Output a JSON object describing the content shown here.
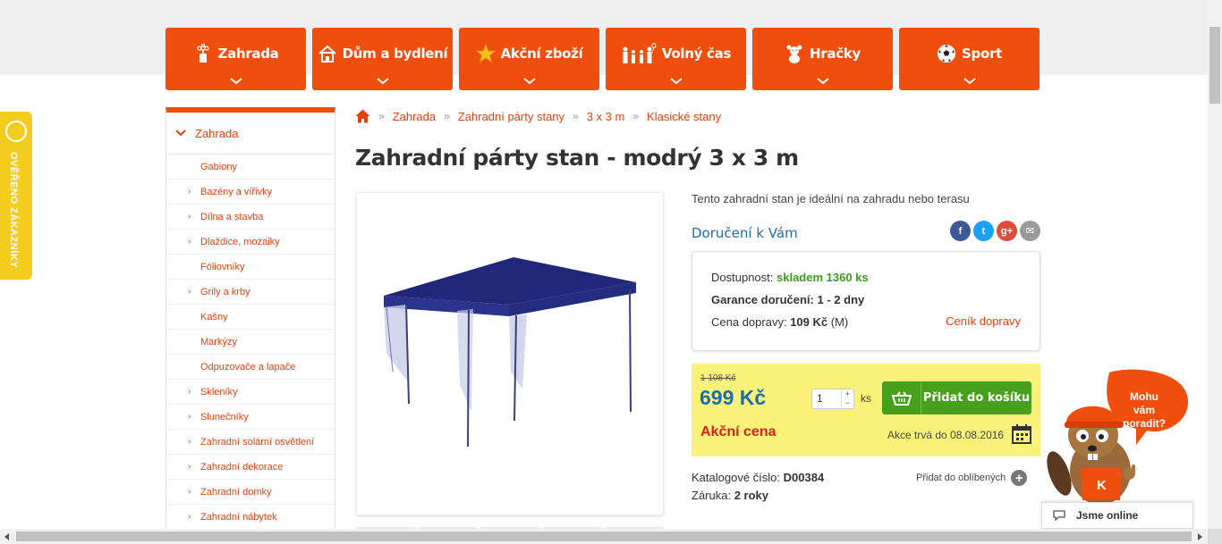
{
  "nav": [
    {
      "label": "Zahrada",
      "icon": "flower-icon"
    },
    {
      "label": "Dům a bydlení",
      "icon": "house-icon"
    },
    {
      "label": "Akční zboží",
      "icon": "star-icon"
    },
    {
      "label": "Volný čas",
      "icon": "family-icon"
    },
    {
      "label": "Hračky",
      "icon": "teddy-bear-icon"
    },
    {
      "label": "Sport",
      "icon": "football-icon"
    }
  ],
  "badge": {
    "text": "OVĚŘENO ZÁKAZNÍKY"
  },
  "sidebar": {
    "head": "Zahrada",
    "items": [
      {
        "label": "Gabiony",
        "has_children": false
      },
      {
        "label": "Bazény a vířivky",
        "has_children": true
      },
      {
        "label": "Dílna a stavba",
        "has_children": true
      },
      {
        "label": "Dlaždice, mozaiky",
        "has_children": true
      },
      {
        "label": "Fóliovníky",
        "has_children": false
      },
      {
        "label": "Grily a krby",
        "has_children": true
      },
      {
        "label": "Kašny",
        "has_children": false
      },
      {
        "label": "Markýzy",
        "has_children": false
      },
      {
        "label": "Odpuzovače a lapače",
        "has_children": false
      },
      {
        "label": "Skleníky",
        "has_children": true
      },
      {
        "label": "Slunečníky",
        "has_children": true
      },
      {
        "label": "Zahradní solární osvětlení",
        "has_children": true
      },
      {
        "label": "Zahradní dekorace",
        "has_children": true
      },
      {
        "label": "Zahradní domky",
        "has_children": true
      },
      {
        "label": "Zahradní nábytek",
        "has_children": true
      }
    ]
  },
  "breadcrumb": [
    "Zahrada",
    "Zahradní párty stany",
    "3 x 3 m",
    "Klasické stany"
  ],
  "product": {
    "title": "Zahradní párty stan - modrý 3 x 3 m",
    "description": "Tento zahradní stan je ideální na zahradu nebo terasu",
    "delivery_heading": "Doručení k Vám",
    "availability_label": "Dostupnost:",
    "availability_value": "skladem 1360 ks",
    "guarantee_label": "Garance doručení:",
    "guarantee_value": "1 - 2 dny",
    "shipping_label": "Cena dopravy:",
    "shipping_value": "109 Kč",
    "shipping_size": "(M)",
    "shipping_link": "Ceník dopravy",
    "old_price": "1 108 Kč",
    "price": "699 Kč",
    "quantity": "1",
    "unit": "ks",
    "add_to_cart": "Přidat do košíku",
    "action_label": "Akční cena",
    "action_until": "Akce trvá do 08.08.2016",
    "catalog_label": "Katalogové číslo:",
    "catalog_value": "D00384",
    "warranty_label": "Záruka:",
    "warranty_value": "2 roky",
    "favorites": "Přidat do oblíbených"
  },
  "social": [
    {
      "icon": "facebook-icon",
      "glyph": "f",
      "color": "#3b5998"
    },
    {
      "icon": "twitter-icon",
      "glyph": "t",
      "color": "#1da1f2"
    },
    {
      "icon": "google-plus-icon",
      "glyph": "g+",
      "color": "#dd4b39"
    },
    {
      "icon": "email-icon",
      "glyph": "✉",
      "color": "#9a9a9a"
    }
  ],
  "chat": {
    "bubble": "Mohu vám poradit?",
    "status": "Jsme online"
  },
  "colors": {
    "accent": "#f04e0c",
    "link": "#e2400c",
    "blue": "#1b6fa8",
    "green": "#47a01b",
    "price_bg": "#fbf27a"
  }
}
